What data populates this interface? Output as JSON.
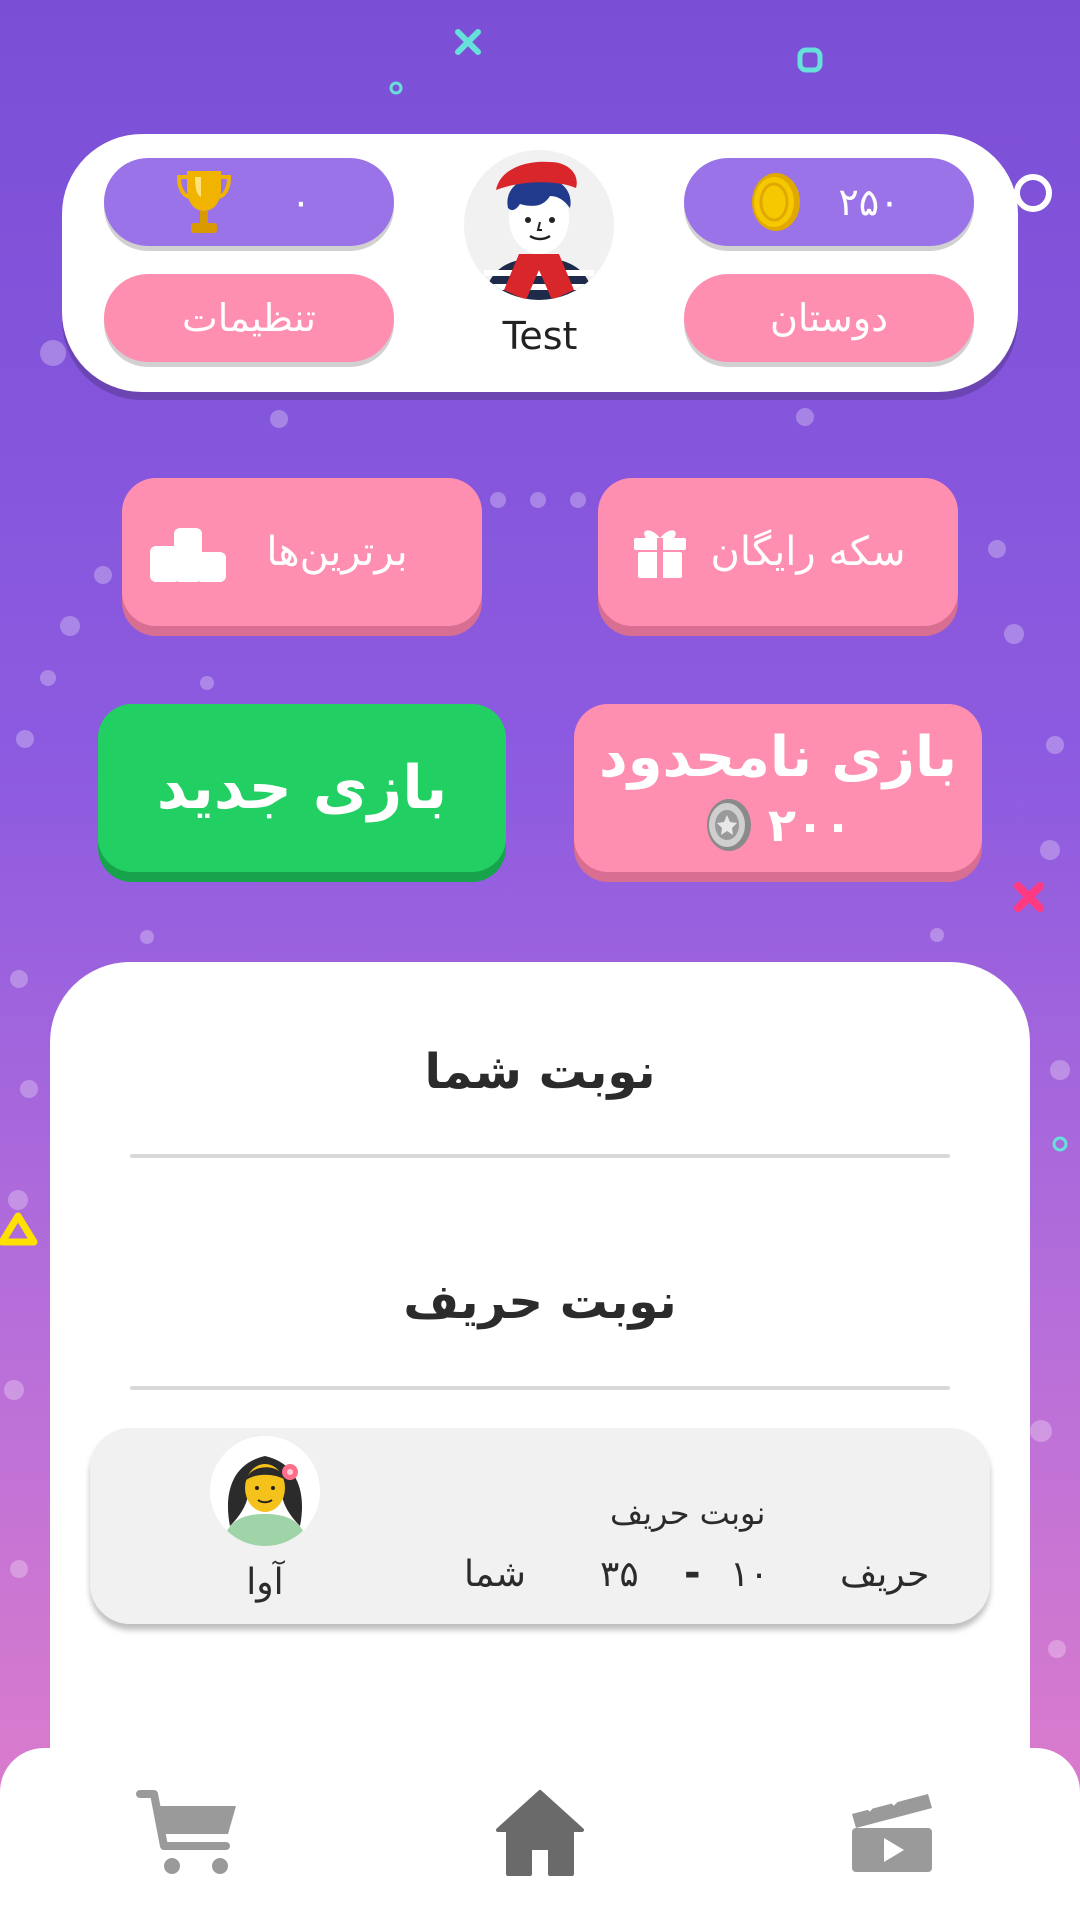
{
  "header": {
    "username": "Test",
    "trophies": "۰",
    "coins": "۲۵۰",
    "settings_label": "تنظیمات",
    "friends_label": "دوستان"
  },
  "actions": {
    "leaderboard_label": "برترین‌ها",
    "free_coins_label": "سکه رایگان",
    "new_game_label": "بازی جدید",
    "unlimited_label": "بازی نامحدود",
    "unlimited_cost": "۲۰۰"
  },
  "games": {
    "your_turn_title": "نوبت شما",
    "opponent_turn_title": "نوبت حریف",
    "items": [
      {
        "status": "نوبت حریف",
        "opponent_name": "آوا",
        "opponent_label": "حریف",
        "you_label": "شما",
        "opponent_score": "۱۰",
        "separator": "-",
        "your_score": "۳۵"
      }
    ]
  },
  "nav": {
    "items": [
      "cart-icon",
      "home-icon",
      "video-icon"
    ],
    "active": "home-icon"
  },
  "colors": {
    "pink": "#ff8fb1",
    "green": "#22cf63",
    "purple_pill": "#9b73e9",
    "gold": "#f2c200"
  }
}
